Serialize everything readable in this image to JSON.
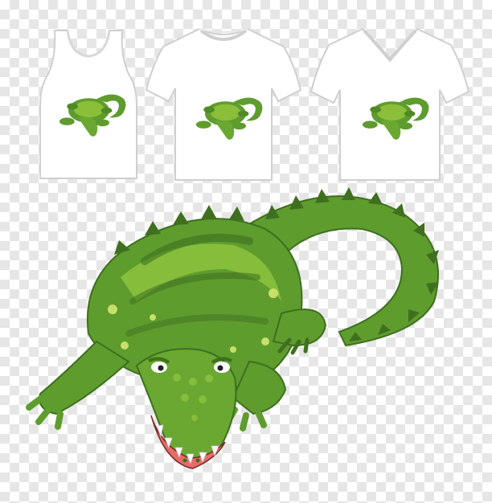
{
  "colors": {
    "checker_light": "#ffffff",
    "checker_dark": "#e6e6e6",
    "shirt_fill": "#ffffff",
    "shirt_outline": "#cfcfcf",
    "shirt_shadow": "#ececec",
    "croc_body": "#5e9c2e",
    "croc_light": "#9ccb3e",
    "croc_dark": "#3f6f1f",
    "croc_spots": "#c6e06a",
    "mouth_pink": "#e86b6b",
    "teeth": "#ffffff"
  },
  "items": [
    {
      "kind": "tank-top",
      "icon": "tank-top-icon"
    },
    {
      "kind": "t-shirt-crew-neck",
      "icon": "t-shirt-icon"
    },
    {
      "kind": "t-shirt-v-neck",
      "icon": "v-neck-shirt-icon"
    }
  ],
  "main_figure": {
    "icon": "crocodile-icon"
  }
}
